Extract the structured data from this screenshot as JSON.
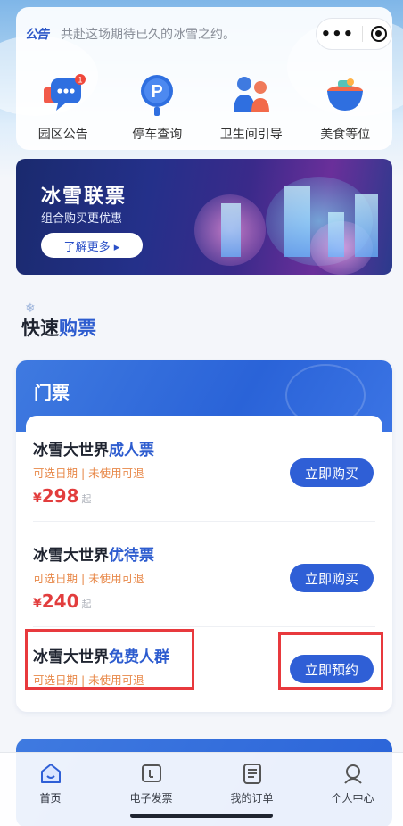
{
  "notice": {
    "tag": "公告",
    "text": "共赴这场期待已久的冰雪之约。"
  },
  "quick_actions": [
    {
      "label": "园区公告",
      "icon": "announcement-chat-icon",
      "badge": "1"
    },
    {
      "label": "停车查询",
      "icon": "parking-icon"
    },
    {
      "label": "卫生间引导",
      "icon": "restroom-icon"
    },
    {
      "label": "美食等位",
      "icon": "food-bowl-icon"
    }
  ],
  "banner": {
    "title": "冰雪联票",
    "subtitle": "组合购买更优惠",
    "button": "了解更多 ▸"
  },
  "section": {
    "title_part1": "快速",
    "title_part2": "购票"
  },
  "ticket_card": {
    "header": "门票",
    "tickets": [
      {
        "name_prefix": "冰雪大世界",
        "name_highlight": "成人票",
        "conditions": "可选日期 | 未使用可退",
        "currency": "¥",
        "price": "298",
        "price_suffix": "起",
        "button": "立即购买"
      },
      {
        "name_prefix": "冰雪大世界",
        "name_highlight": "优待票",
        "conditions": "可选日期 | 未使用可退",
        "currency": "¥",
        "price": "240",
        "price_suffix": "起",
        "button": "立即购买"
      },
      {
        "name_prefix": "冰雪大世界",
        "name_highlight": "免费人群",
        "conditions": "可选日期 | 未使用可退",
        "button": "立即预约"
      }
    ]
  },
  "tabbar": [
    {
      "label": "首页",
      "icon": "home-icon",
      "active": true
    },
    {
      "label": "电子发票",
      "icon": "invoice-icon"
    },
    {
      "label": "我的订单",
      "icon": "order-list-icon"
    },
    {
      "label": "个人中心",
      "icon": "user-icon"
    }
  ],
  "colors": {
    "accent": "#2f5fd6",
    "price": "#e23d3d",
    "condition": "#e8894a",
    "highlight_box": "#e8393d"
  }
}
